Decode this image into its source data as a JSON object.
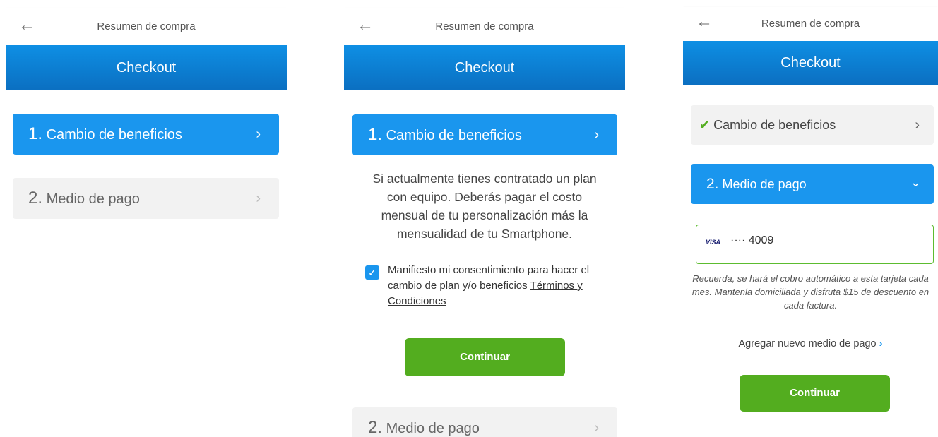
{
  "header": {
    "title": "Resumen de compra",
    "back_icon": "←"
  },
  "hero": {
    "title": "Checkout"
  },
  "steps": {
    "step1": {
      "number": "1.",
      "label": "Cambio de beneficios"
    },
    "step2": {
      "number": "2.",
      "label": "Medio de pago"
    },
    "chevron_right": "›",
    "chevron_down": "⌄",
    "check_glyph": "✔"
  },
  "info": {
    "text": "Si actualmente tienes contratado un plan con equipo. Deberás pagar el costo mensual de tu personalización más la mensualidad de tu Smartphone.",
    "consent": "Manifiesto mi consentimiento para hacer el cambio de plan y/o beneficios ",
    "terms_link": "Términos y Condiciones",
    "checkbox_glyph": "✓"
  },
  "buttons": {
    "continue": "Continuar"
  },
  "payment": {
    "card_brand": "VISA",
    "card_mask": "···· 4009",
    "note": "Recuerda, se hará el cobro automático a esta tarjeta cada mes. Mantenla domiciliada y disfruta $15 de descuento en cada factura.",
    "add_method": "Agregar nuevo medio de pago",
    "add_chevron": "›"
  },
  "colors": {
    "primary_blue": "#1a96ee",
    "green": "#53ad1f",
    "inactive_gray": "#f2f2f2"
  }
}
